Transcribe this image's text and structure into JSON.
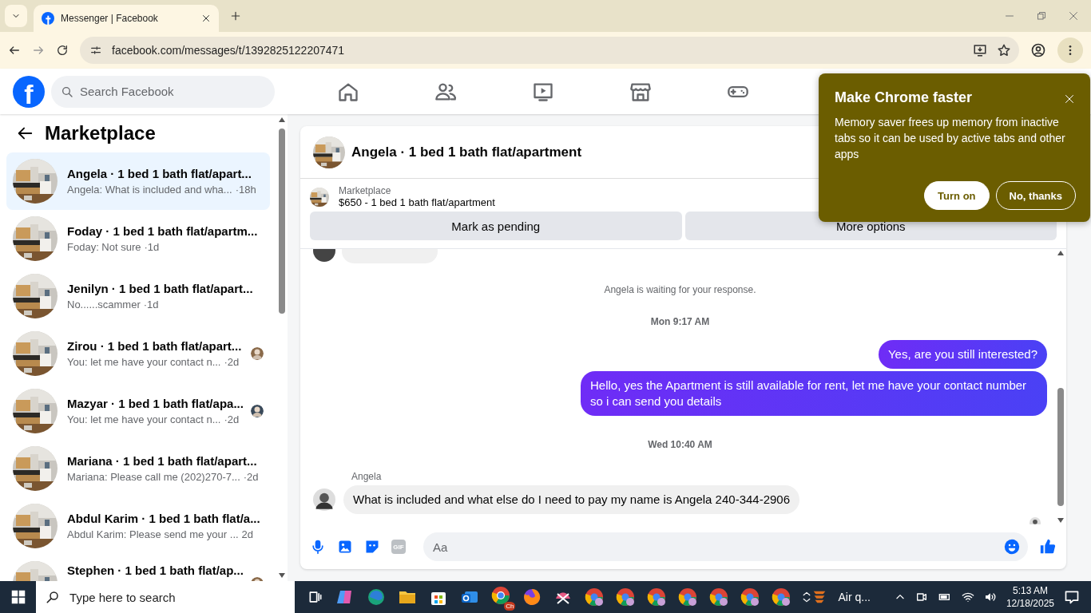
{
  "browser": {
    "tab_title": "Messenger | Facebook",
    "url": "facebook.com/messages/t/1392825122207471"
  },
  "facebook": {
    "logo": "f",
    "search_placeholder": "Search Facebook"
  },
  "sidebar": {
    "title": "Marketplace",
    "conversations": [
      {
        "name": "Angela · 1 bed 1 bath flat/apart...",
        "preview": "Angela: What is included and wha...",
        "time": "·18h",
        "selected": true,
        "read_receipt": false
      },
      {
        "name": "Foday · 1 bed 1 bath flat/apartm...",
        "preview": "Foday: Not sure",
        "time": "·1d",
        "selected": false,
        "read_receipt": false
      },
      {
        "name": "Jenilyn · 1 bed 1 bath flat/apart...",
        "preview": "No......scammer",
        "time": "·1d",
        "selected": false,
        "read_receipt": false
      },
      {
        "name": "Zirou · 1 bed 1 bath flat/apart...",
        "preview": "You: let me have your contact n...",
        "time": "·2d",
        "selected": false,
        "read_receipt": true
      },
      {
        "name": "Mazyar · 1 bed 1 bath flat/apa...",
        "preview": "You: let me have your contact n...",
        "time": "·2d",
        "selected": false,
        "read_receipt": true
      },
      {
        "name": "Mariana · 1 bed 1 bath flat/apart...",
        "preview": "Mariana: Please call me (202)270-7...",
        "time": "·2d",
        "selected": false,
        "read_receipt": false
      },
      {
        "name": "Abdul Karim · 1 bed 1 bath flat/a...",
        "preview": "Abdul Karim: Please send me your ...",
        "time": "2d",
        "selected": false,
        "read_receipt": false
      },
      {
        "name": "Stephen · 1 bed 1 bath flat/ap...",
        "selected": false,
        "read_receipt": true
      }
    ]
  },
  "chat": {
    "title": "Angela · 1 bed 1 bath flat/apartment",
    "listing": {
      "label": "Marketplace",
      "title": "$650 - 1 bed 1 bath flat/apartment"
    },
    "actions": [
      "Mark as pending",
      "More options"
    ],
    "messages": [
      {
        "kind": "status",
        "text": "Angela is waiting for your response."
      },
      {
        "kind": "time",
        "text": "Mon 9:17 AM"
      },
      {
        "kind": "outgoing",
        "text": "Yes, are you still interested?"
      },
      {
        "kind": "outgoing",
        "text": "Hello, yes the Apartment is still available for rent, let me have your contact number so i can send you details"
      },
      {
        "kind": "time",
        "text": "Wed 10:40 AM"
      },
      {
        "kind": "incoming",
        "sender": "Angela",
        "text": "What is included and what else do I need to pay my name is Angela 240-344-2906"
      }
    ],
    "composer": {
      "placeholder": "Aa",
      "gif": "GIF"
    }
  },
  "popup": {
    "title": "Make Chrome faster",
    "body": "Memory saver frees up memory from inactive tabs so it can be used by active tabs and other apps",
    "buttons": [
      "Turn on",
      "No, thanks"
    ]
  },
  "taskbar": {
    "search_placeholder": "Type here to search",
    "chrome_badge": "Ch",
    "weather": "Air q...",
    "time": "5:13 AM",
    "date": "12/18/2025"
  }
}
